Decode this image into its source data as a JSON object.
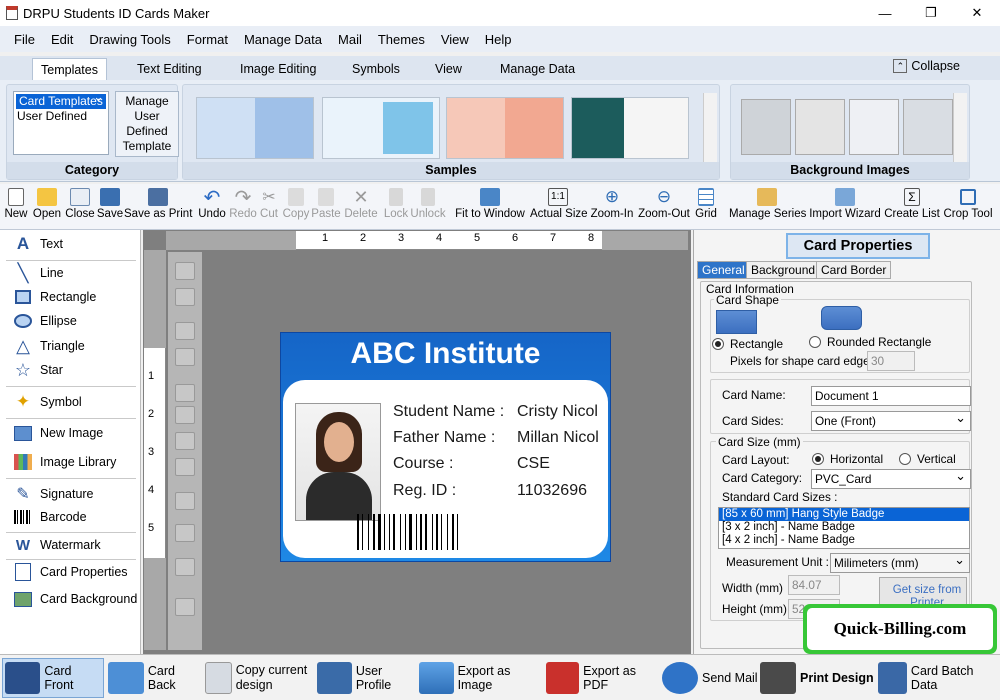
{
  "app": {
    "title": "DRPU Students ID Cards Maker",
    "minimize": "—",
    "maximize": "❐",
    "close": "✕"
  },
  "menu": [
    "File",
    "Edit",
    "Drawing Tools",
    "Format",
    "Manage Data",
    "Mail",
    "Themes",
    "View",
    "Help"
  ],
  "ribbon_tabs": [
    "Templates",
    "Text Editing",
    "Image Editing",
    "Symbols",
    "View",
    "Manage Data"
  ],
  "collapse_label": "Collapse",
  "category": {
    "label": "Category",
    "items": [
      "Card Templates",
      "User Defined"
    ],
    "manage_button": "Manage User Defined Template"
  },
  "samples_label": "Samples",
  "bg_images_label": "Background Images",
  "toolbar": [
    "New",
    "Open",
    "Close",
    "Save",
    "Save as Print",
    "Undo",
    "Redo",
    "Cut",
    "Copy",
    "Paste",
    "Delete",
    "Lock",
    "Unlock",
    "Fit to Window",
    "Actual Size",
    "Zoom-In",
    "Zoom-Out",
    "Grid",
    "Manage Series",
    "Import Wizard",
    "Create List",
    "Crop Tool"
  ],
  "actual_size_glyph": "1:1",
  "create_list_glyph": "Σ",
  "tools": [
    "Text",
    "Line",
    "Rectangle",
    "Ellipse",
    "Triangle",
    "Star",
    "Symbol",
    "New Image",
    "Image Library",
    "Signature",
    "Barcode",
    "Watermark",
    "Card Properties",
    "Card Background"
  ],
  "ruler_top": [
    "1",
    "2",
    "3",
    "4",
    "5",
    "6",
    "7",
    "8"
  ],
  "ruler_left": [
    "1",
    "2",
    "3",
    "4",
    "5"
  ],
  "card": {
    "title": "ABC Institute",
    "rows": [
      {
        "label": "Student Name :",
        "value": "Cristy Nicol"
      },
      {
        "label": "Father Name :",
        "value": "Millan Nicol"
      },
      {
        "label": "Course :",
        "value": "CSE"
      },
      {
        "label": "Reg. ID :",
        "value": "11032696"
      }
    ]
  },
  "props": {
    "title": "Card Properties",
    "tabs": [
      "General",
      "Background",
      "Card Border"
    ],
    "card_information": "Card Information",
    "card_shape": "Card Shape",
    "rectangle": "Rectangle",
    "rounded_rectangle": "Rounded Rectangle",
    "pixels_label": "Pixels for shape card edge :",
    "pixels_value": "30",
    "card_name_label": "Card Name:",
    "card_name_value": "Document 1",
    "card_sides_label": "Card Sides:",
    "card_sides_value": "One (Front)",
    "card_size_label": "Card Size (mm)",
    "card_layout_label": "Card Layout:",
    "horizontal": "Horizontal",
    "vertical": "Vertical",
    "card_category_label": "Card Category:",
    "card_category_value": "PVC_Card",
    "standard_sizes_label": "Standard Card Sizes :",
    "standard_sizes": [
      "[85 x 60 mm] Hang Style Badge",
      "[3 x 2 inch] - Name Badge",
      "[4 x 2 inch] - Name Badge"
    ],
    "measurement_label": "Measurement Unit :",
    "measurement_value": "Milimeters (mm)",
    "width_label": "Width  (mm)",
    "width_value": "84.07",
    "height_label": "Height  (mm)",
    "height_value": "52.32",
    "get_size": "Get size from Printer"
  },
  "bottom": [
    "Card Front",
    "Card Back",
    "Copy current design",
    "User Profile",
    "Export as Image",
    "Export as PDF",
    "Send Mail",
    "Print Design",
    "Card Batch Data"
  ],
  "quick_billing": "Quick-Billing.com"
}
